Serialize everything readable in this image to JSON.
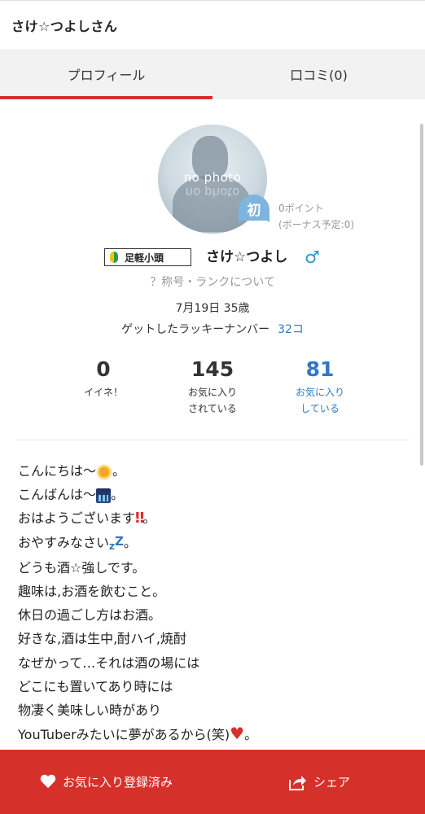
{
  "header": {
    "title": "さけ☆つよしさん"
  },
  "tabs": [
    {
      "label": "プロフィール",
      "active": true
    },
    {
      "label": "口コミ(0)",
      "active": false
    }
  ],
  "profile": {
    "avatar_text": "no photo",
    "badge_label": "初",
    "points": "0ポイント",
    "bonus": "(ボーナス予定:0)",
    "rank_title": "足軽小頭",
    "name": "さけ☆つよし",
    "gender_symbol": "♂",
    "rank_link": "？称号・ランクについて",
    "birthday_age": "7月19日 35歳",
    "lucky_label": "ゲットしたラッキーナンバー",
    "lucky_value": "32コ"
  },
  "stats": [
    {
      "value": "0",
      "label1": "イイネ！",
      "label2": ""
    },
    {
      "value": "145",
      "label1": "お気に入り",
      "label2": "されている"
    },
    {
      "value": "81",
      "label1": "お気に入り",
      "label2": "している"
    }
  ],
  "bio": {
    "l1": "こんにちは〜",
    "l1_end": "。",
    "l2": "こんばんは〜",
    "l2_end": "。",
    "l3": "おはようございます",
    "l3_emoji": "‼",
    "l3_end": "。",
    "l4": "おやすみなさい",
    "l4_emoji_small": "z",
    "l4_emoji_big": "Z",
    "l4_end": "。",
    "l5": "どうも酒☆強しです。",
    "l6": "趣味は,お酒を飲むこと。",
    "l7": "休日の過ごし方はお酒。",
    "l8": "好きな,酒は生中,酎ハイ,焼酎",
    "l9": "なぜかって…それは酒の場には",
    "l10": "どこにも置いてあり時には",
    "l11": "物凄く美味しい時があり",
    "l12": "YouTuberみたいに夢があるから(笑)",
    "l12_emoji": "♥",
    "l12_end": "。"
  },
  "bottom_bar": {
    "favorite_label": "お気に入り登録済み",
    "share_label": "シェア"
  },
  "colors": {
    "accent": "#d6302b",
    "link": "#2f78c8",
    "badge": "#7db4e0"
  }
}
